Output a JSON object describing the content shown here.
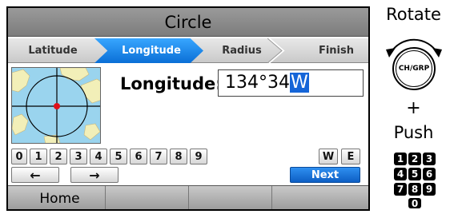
{
  "screen": {
    "title": "Circle",
    "steps": [
      {
        "label": "Latitude",
        "active": false
      },
      {
        "label": "Longitude",
        "active": true
      },
      {
        "label": "Radius",
        "active": false
      },
      {
        "label": "Finish",
        "active": false
      }
    ],
    "field": {
      "label": "Longitude:",
      "value": "134°34",
      "cursor_char": "W"
    },
    "keypad": {
      "digits": [
        "0",
        "1",
        "2",
        "3",
        "4",
        "5",
        "6",
        "7",
        "8",
        "9"
      ],
      "hemisphere": [
        "W",
        "E"
      ],
      "left_arrow": "←",
      "right_arrow": "→",
      "next": "Next"
    },
    "softkeys": [
      "Home",
      "",
      "",
      ""
    ]
  },
  "guide": {
    "rotate": "Rotate",
    "knob_label": "CH/GRP",
    "plus": "+",
    "push": "Push",
    "numbers": [
      "1",
      "2",
      "3",
      "4",
      "5",
      "6",
      "7",
      "8",
      "9",
      "0"
    ]
  },
  "colors": {
    "accent": "#1f86ee",
    "map_water": "#9ad4ee",
    "map_land": "#f2efb8",
    "marker": "#e0101a"
  }
}
